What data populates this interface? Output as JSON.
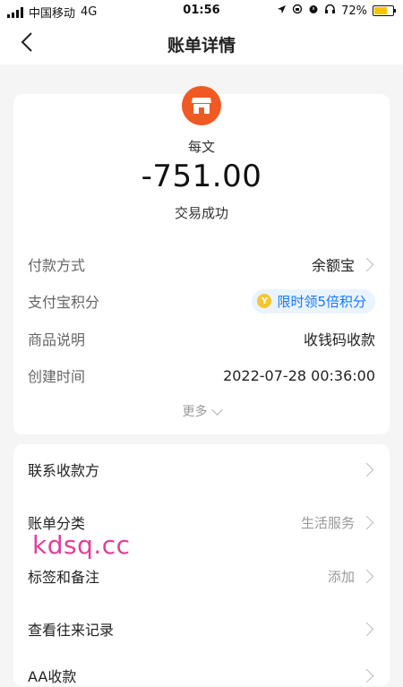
{
  "status_bar": {
    "carrier": "中国移动",
    "network": "4G",
    "time": "01:56",
    "battery": "72%",
    "battery_level": 0.72
  },
  "header": {
    "title": "账单详情"
  },
  "summary": {
    "merchant": "每文",
    "amount": "-751.00",
    "status": "交易成功",
    "icon": "store-icon",
    "icon_color": "#f05a22"
  },
  "details": [
    {
      "label": "付款方式",
      "value": "余额宝"
    },
    {
      "label": "支付宝积分",
      "value": "限时领5倍积分"
    },
    {
      "label": "商品说明",
      "value": "收钱码收款"
    },
    {
      "label": "创建时间",
      "value": "2022-07-28 00:36:00"
    }
  ],
  "more_label": "更多",
  "actions": [
    {
      "label": "联系收款方",
      "value": ""
    },
    {
      "label": "账单分类",
      "value": "生活服务"
    },
    {
      "label": "标签和备注",
      "value": "添加"
    },
    {
      "label": "查看往来记录",
      "value": ""
    },
    {
      "label": "AA收款",
      "value": ""
    }
  ],
  "watermark": "kdsq.cc",
  "colors": {
    "accent_blue": "#1677ff",
    "badge_bg": "#eaf4ff",
    "watermark": "#e0409a"
  }
}
